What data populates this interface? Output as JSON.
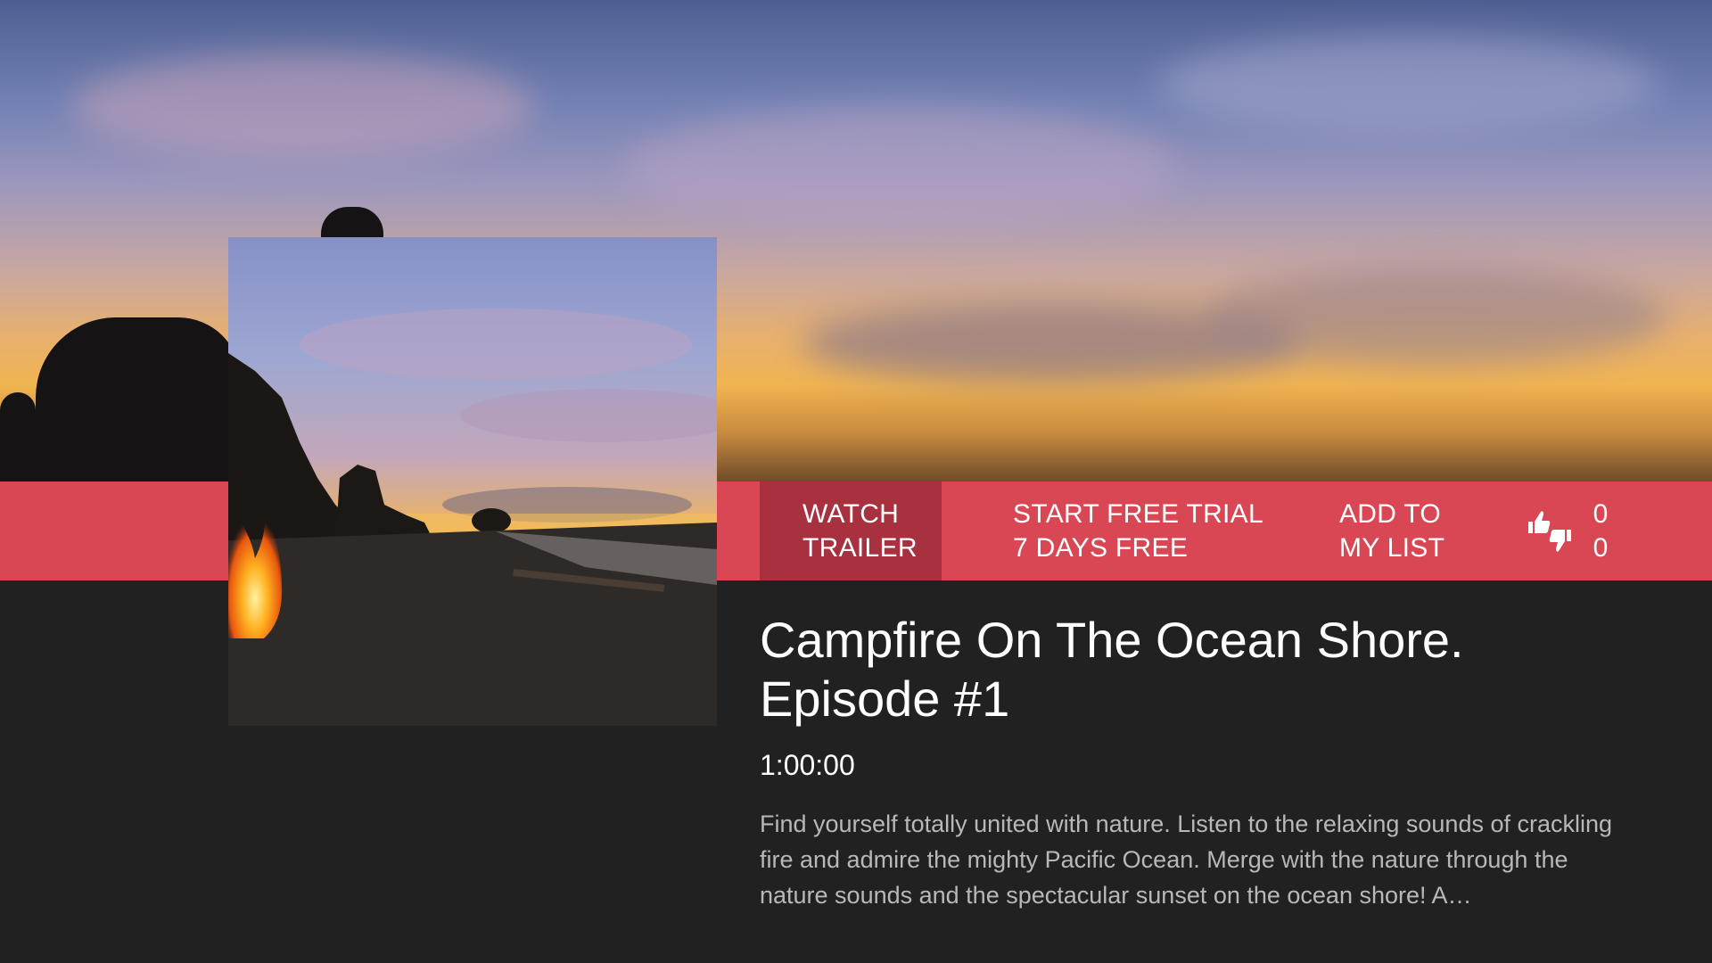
{
  "theme": {
    "accent": "#d94754",
    "accent_active": "#a8313f",
    "background": "#212121"
  },
  "background": {
    "image": "sunset-beach-hero-image"
  },
  "poster": {
    "image": "campfire-beach-poster-image"
  },
  "actions": {
    "watch_trailer": {
      "line1": "WATCH",
      "line2": "TRAILER",
      "active": true
    },
    "free_trial": {
      "line1": "START FREE TRIAL",
      "line2": "7 DAYS FREE"
    },
    "my_list": {
      "line1": "ADD TO",
      "line2": "MY LIST"
    },
    "rating": {
      "icon": "thumbs-up-down-icon",
      "likes": "0",
      "dislikes": "0"
    }
  },
  "content": {
    "title": "Campfire On The Ocean Shore. Episode #1",
    "duration": "1:00:00",
    "description": "Find yourself totally united with nature. Listen to the relaxing sounds of crackling fire and admire the mighty Pacific Ocean. Merge with the nature through the nature sounds and the spectacular sunset on the ocean shore! A…"
  }
}
